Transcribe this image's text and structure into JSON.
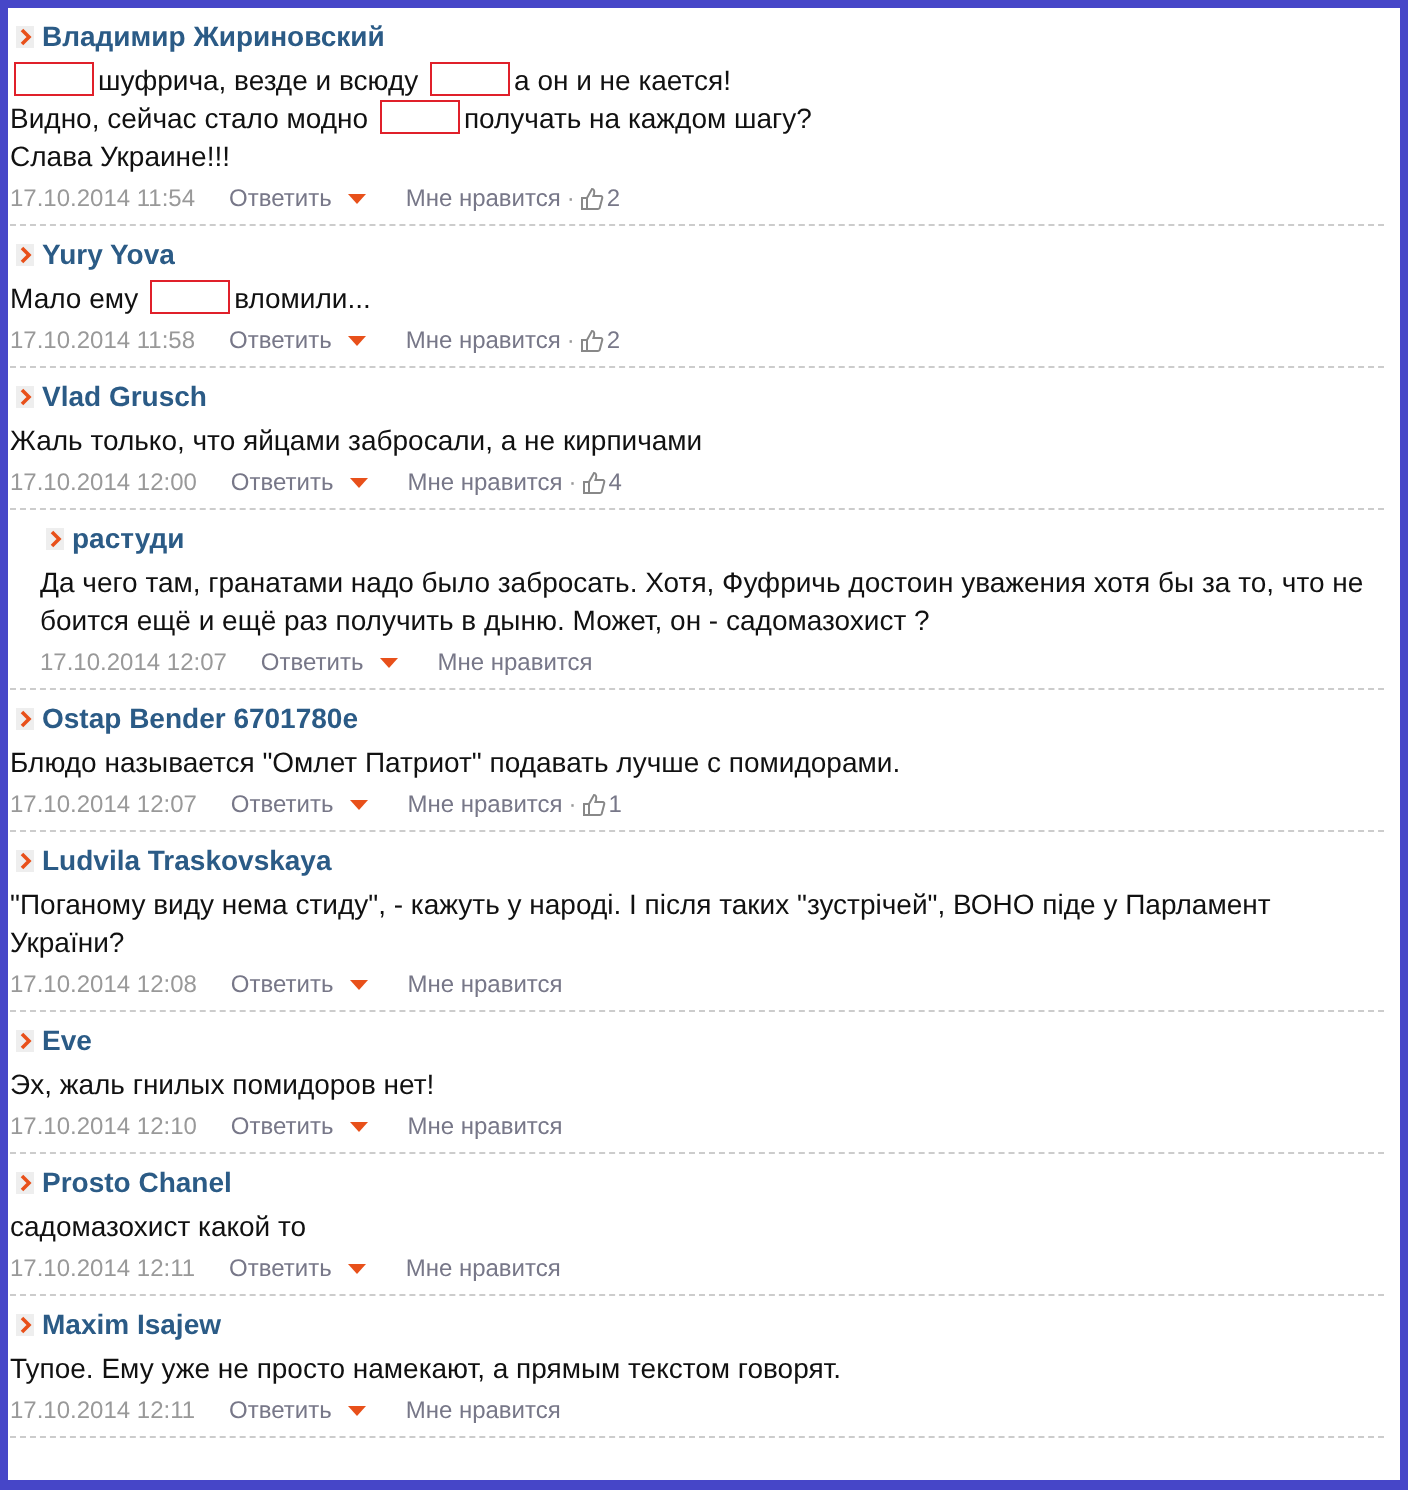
{
  "comments": [
    {
      "author": "Владимир Жириновский",
      "lines": [
        [
          {
            "kind": "redacted"
          },
          {
            "kind": "text",
            "text": "шуфрича, везде и всюду"
          },
          {
            "kind": "redacted"
          },
          {
            "kind": "text",
            "text": "а он и не кается!"
          }
        ],
        [
          {
            "kind": "text",
            "text": "Видно, сейчас стало модно"
          },
          {
            "kind": "redacted"
          },
          {
            "kind": "text",
            "text": "получать на каждом шагу?"
          }
        ],
        [
          {
            "kind": "text",
            "text": "Слава Украине!!!"
          }
        ]
      ],
      "date": "17.10.2014 11:54",
      "reply": "Ответить",
      "like": "Мне нравится",
      "separator": "·",
      "likes": "2"
    },
    {
      "author": "Yury Yova",
      "lines": [
        [
          {
            "kind": "text",
            "text": "Мало ему"
          },
          {
            "kind": "redacted"
          },
          {
            "kind": "text",
            "text": "вломили..."
          }
        ]
      ],
      "date": "17.10.2014 11:58",
      "reply": "Ответить",
      "like": "Мне нравится",
      "separator": "·",
      "likes": "2"
    },
    {
      "author": "Vlad Grusch",
      "lines": [
        [
          {
            "kind": "text",
            "text": "Жаль только, что яйцами забросали, а не кирпичами"
          }
        ]
      ],
      "date": "17.10.2014 12:00",
      "reply": "Ответить",
      "like": "Мне нравится",
      "separator": "·",
      "likes": "4",
      "children": [
        {
          "author": "растуди",
          "lines": [
            [
              {
                "kind": "text",
                "text": "Да чего там, гранатами надо было забросать. Хотя, Фуфричь достоин уважения хотя бы за то, что не боится ещё и ещё раз получить в дыню. Может, он - садомазохист ?"
              }
            ]
          ],
          "date": "17.10.2014 12:07",
          "reply": "Ответить",
          "like": "Мне нравится"
        }
      ]
    },
    {
      "author": "Ostap Bender 6701780e",
      "lines": [
        [
          {
            "kind": "text",
            "text": "Блюдо называется \"Омлет Патриот\" подавать лучше с помидорами."
          }
        ]
      ],
      "date": "17.10.2014 12:07",
      "reply": "Ответить",
      "like": "Мне нравится",
      "separator": "·",
      "likes": "1"
    },
    {
      "author": "Ludvila Traskovskaya",
      "lines": [
        [
          {
            "kind": "text",
            "text": "\"Поганому виду нема стиду\", - кажуть у народі. І після таких \"зустрічей\", ВОНО піде у Парламент України?"
          }
        ]
      ],
      "date": "17.10.2014 12:08",
      "reply": "Ответить",
      "like": "Мне нравится"
    },
    {
      "author": "Eve",
      "lines": [
        [
          {
            "kind": "text",
            "text": "Эх, жаль гнилых помидоров нет!"
          }
        ]
      ],
      "date": "17.10.2014 12:10",
      "reply": "Ответить",
      "like": "Мне нравится"
    },
    {
      "author": "Prosto Chanel",
      "lines": [
        [
          {
            "kind": "text",
            "text": "садомазохист какой то"
          }
        ]
      ],
      "date": "17.10.2014 12:11",
      "reply": "Ответить",
      "like": "Мне нравится"
    },
    {
      "author": "Maxim Isajew",
      "lines": [
        [
          {
            "kind": "text",
            "text": "Тупое. Ему уже не просто намекают, а прямым текстом говорят."
          }
        ]
      ],
      "date": "17.10.2014 12:11",
      "reply": "Ответить",
      "like": "Мне нравится"
    }
  ]
}
